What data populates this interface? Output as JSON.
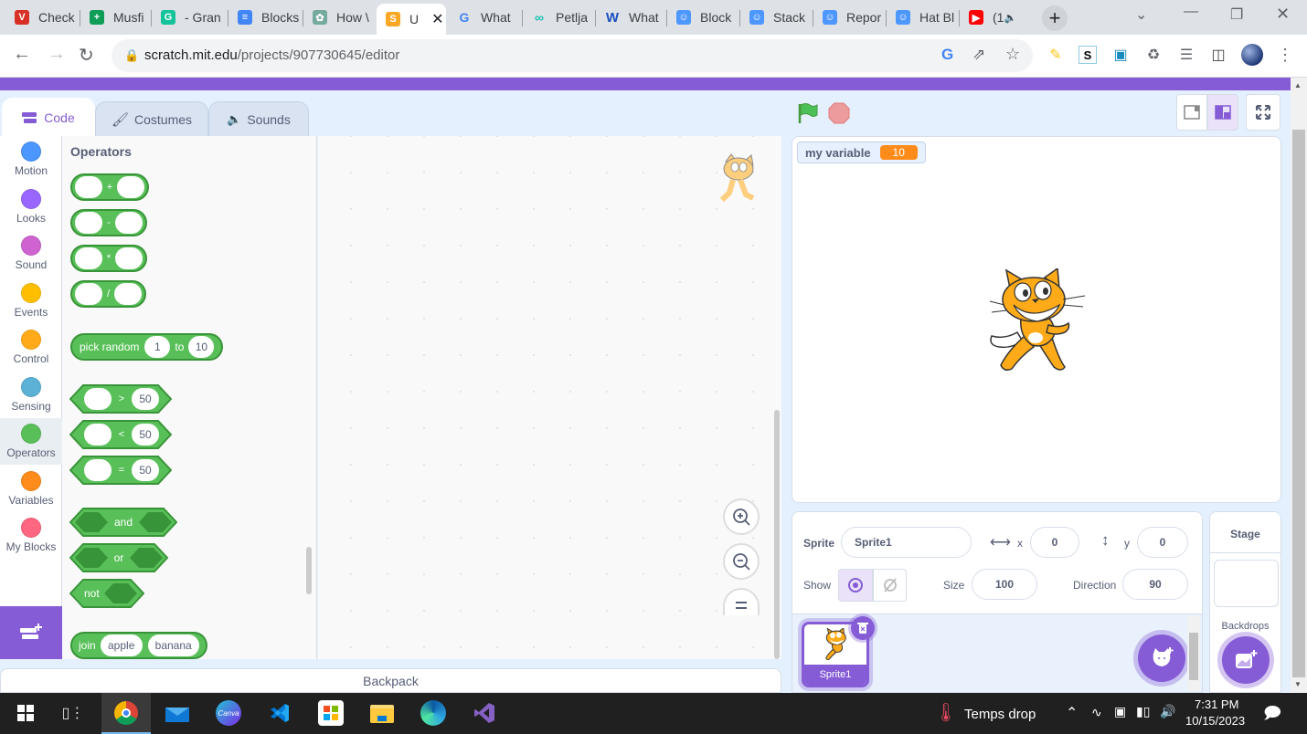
{
  "browser": {
    "tabs": [
      {
        "label": "Check",
        "icon": "checkmark-app-icon",
        "color": "#d93025"
      },
      {
        "label": "Musfi",
        "icon": "google-sheets-icon",
        "color": "#0f9d58"
      },
      {
        "label": "- Gran",
        "icon": "grammarly-icon",
        "color": "#15c39a"
      },
      {
        "label": "Blocks",
        "icon": "google-docs-icon",
        "color": "#4285f4"
      },
      {
        "label": "How \\",
        "icon": "chatgpt-icon",
        "color": "#74aa9c"
      },
      {
        "label": "U",
        "icon": "scratch-s-icon",
        "color": "#f9a825",
        "active": true
      },
      {
        "label": "What",
        "icon": "google-icon",
        "color": "#4285f4"
      },
      {
        "label": "Petlja",
        "icon": "petlja-icon",
        "color": "#17c3b2"
      },
      {
        "label": "What",
        "icon": "wikipedia-w-icon",
        "color": "#1a4fbf"
      },
      {
        "label": "Block",
        "icon": "scratch-wiki-icon",
        "color": "#4d97ff"
      },
      {
        "label": "Stack",
        "icon": "scratch-wiki-icon",
        "color": "#4d97ff"
      },
      {
        "label": "Repor",
        "icon": "scratch-wiki-icon",
        "color": "#4d97ff"
      },
      {
        "label": "Hat Bl",
        "icon": "scratch-wiki-icon",
        "color": "#4d97ff"
      },
      {
        "label": "(1",
        "icon": "youtube-icon",
        "color": "#ff0000"
      }
    ],
    "url_host": "scratch.mit.edu",
    "url_path": "/projects/907730645/editor"
  },
  "editor": {
    "tabs": {
      "code": "Code",
      "costumes": "Costumes",
      "sounds": "Sounds"
    },
    "categories": [
      {
        "label": "Motion",
        "color": "#4c97ff"
      },
      {
        "label": "Looks",
        "color": "#9966ff"
      },
      {
        "label": "Sound",
        "color": "#cf63cf"
      },
      {
        "label": "Events",
        "color": "#ffbf00"
      },
      {
        "label": "Control",
        "color": "#ffab19"
      },
      {
        "label": "Sensing",
        "color": "#5cb1d6"
      },
      {
        "label": "Operators",
        "color": "#59c059",
        "selected": true
      },
      {
        "label": "Variables",
        "color": "#ff8c1a"
      },
      {
        "label": "My Blocks",
        "color": "#ff6680"
      }
    ],
    "palette_heading": "Operators",
    "blocks": {
      "add": "+",
      "subtract": "-",
      "multiply": "*",
      "divide": "/",
      "pick_random": {
        "label": "pick random",
        "from": "1",
        "to_label": "to",
        "to": "10"
      },
      "gt": {
        "op": ">",
        "value": "50"
      },
      "lt": {
        "op": "<",
        "value": "50"
      },
      "eq": {
        "op": "=",
        "value": "50"
      },
      "and": "and",
      "or": "or",
      "not": "not",
      "join": {
        "label": "join",
        "a": "apple",
        "b": "banana"
      }
    },
    "backpack": "Backpack"
  },
  "stage": {
    "variable_name": "my variable",
    "variable_value": "10"
  },
  "sprite_info": {
    "sprite_label": "Sprite",
    "sprite_name": "Sprite1",
    "x_label": "x",
    "x": "0",
    "y_label": "y",
    "y": "0",
    "show_label": "Show",
    "size_label": "Size",
    "size": "100",
    "direction_label": "Direction",
    "direction": "90"
  },
  "sprites": [
    {
      "name": "Sprite1"
    }
  ],
  "stage_pane": {
    "title": "Stage",
    "backdrops_label": "Backdrops"
  },
  "taskbar": {
    "weather": "Temps drop",
    "time": "7:31 PM",
    "date": "10/15/2023"
  }
}
